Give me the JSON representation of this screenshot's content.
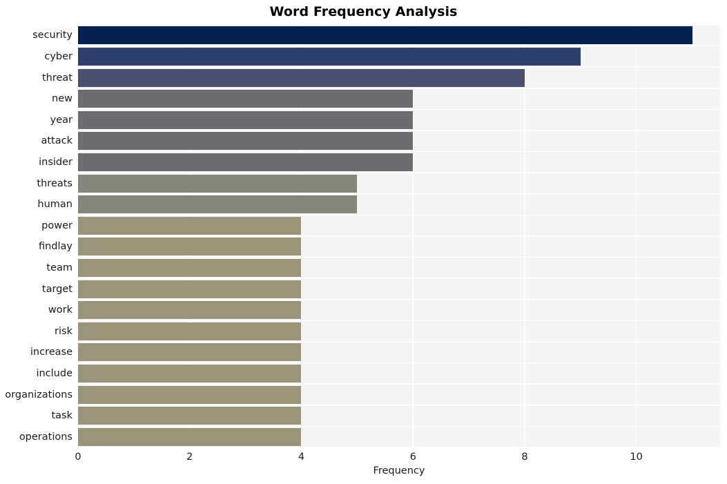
{
  "chart_data": {
    "type": "bar",
    "orientation": "horizontal",
    "title": "Word Frequency Analysis",
    "xlabel": "Frequency",
    "ylabel": "",
    "xlim": [
      0,
      11.5
    ],
    "xticks": [
      0,
      2,
      4,
      6,
      8,
      10
    ],
    "grid": true,
    "legend": "none",
    "categories": [
      "security",
      "cyber",
      "threat",
      "new",
      "year",
      "attack",
      "insider",
      "threats",
      "human",
      "power",
      "findlay",
      "team",
      "target",
      "work",
      "risk",
      "increase",
      "include",
      "organizations",
      "task",
      "operations"
    ],
    "values": [
      11,
      9,
      8,
      6,
      6,
      6,
      6,
      5,
      5,
      4,
      4,
      4,
      4,
      4,
      4,
      4,
      4,
      4,
      4,
      4
    ],
    "bar_colors": [
      "#04204f",
      "#2f3f6b",
      "#4a5170",
      "#6b6d71",
      "#6b6d71",
      "#6b6d71",
      "#6b6d71",
      "#84867a",
      "#84867a",
      "#9b9478",
      "#9b9478",
      "#9b9478",
      "#9b9478",
      "#9b9478",
      "#9b9478",
      "#9b9478",
      "#9b9478",
      "#9b9478",
      "#9b9478",
      "#9b9478"
    ],
    "plot_background": "#f4f4f5",
    "grid_color": "#ffffff",
    "figure_background": "#ffffff",
    "text_color": "#1a1a1a"
  }
}
